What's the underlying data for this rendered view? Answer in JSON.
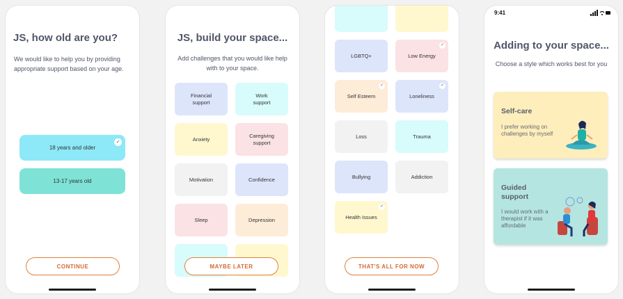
{
  "screen1": {
    "title": "JS, how old are you?",
    "subtitle": "We would like to help you by providing appropriate support based on your age.",
    "options": [
      {
        "label": "18 years and older",
        "selected": true,
        "color": "#8de9f7"
      },
      {
        "label": "13-17 years old",
        "selected": false,
        "color": "#7ee3d6"
      }
    ],
    "cta": "CONTINUE"
  },
  "screen2": {
    "title": "JS, build your space...",
    "subtitle": "Add challenges that you would like help with to your space.",
    "chips": [
      {
        "label": "Financial support"
      },
      {
        "label": "Work support"
      },
      {
        "label": "Anxiety"
      },
      {
        "label": "Caregiving support"
      },
      {
        "label": "Motivation"
      },
      {
        "label": "Confidence"
      },
      {
        "label": "Sleep"
      },
      {
        "label": "Depression"
      }
    ],
    "cta": "MAYBE LATER"
  },
  "screen3": {
    "chips": [
      {
        "label": "LGBTQ+",
        "selected": false
      },
      {
        "label": "Low Energy",
        "selected": true
      },
      {
        "label": "Self Esteem",
        "selected": true
      },
      {
        "label": "Loneliness",
        "selected": true
      },
      {
        "label": "Loss",
        "selected": false
      },
      {
        "label": "Trauma",
        "selected": false
      },
      {
        "label": "Bullying",
        "selected": false
      },
      {
        "label": "Addiction",
        "selected": false
      },
      {
        "label": "Health Issues",
        "selected": true
      }
    ],
    "cta": "THAT'S ALL FOR NOW"
  },
  "screen4": {
    "time": "9:41",
    "title": "Adding to your space...",
    "subtitle": "Choose a style which works best for you",
    "cards": [
      {
        "title": "Self-care",
        "body": "I prefer working on challenges by myself",
        "color": "#fdeebc",
        "illustration": "meditating-person-illustration"
      },
      {
        "title": "Guided support",
        "body": "I would work with a therapist if it was affordable",
        "color": "#b5e5e1",
        "illustration": "therapy-session-illustration"
      }
    ]
  },
  "icons": {
    "check": "✓"
  }
}
